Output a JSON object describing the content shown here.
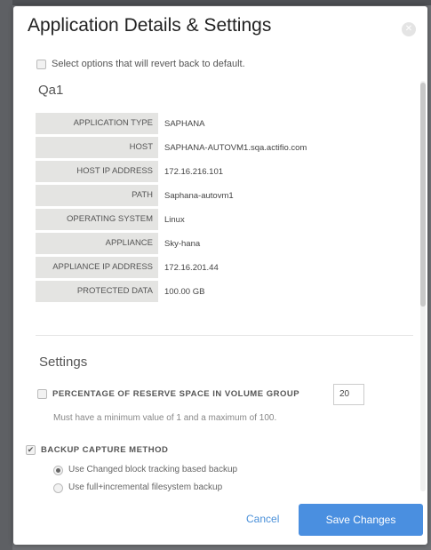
{
  "dialog": {
    "title": "Application Details & Settings",
    "revert_label": "Select options that will revert back to default.",
    "app_name": "Qa1"
  },
  "details": [
    {
      "label": "APPLICATION TYPE",
      "value": "SAPHANA"
    },
    {
      "label": "HOST",
      "value": "SAPHANA-AUTOVM1.sqa.actifio.com"
    },
    {
      "label": "HOST IP ADDRESS",
      "value": "172.16.216.101"
    },
    {
      "label": "PATH",
      "value": "Saphana-autovm1"
    },
    {
      "label": "OPERATING SYSTEM",
      "value": "Linux"
    },
    {
      "label": "APPLIANCE",
      "value": "Sky-hana"
    },
    {
      "label": "APPLIANCE IP ADDRESS",
      "value": "172.16.201.44"
    },
    {
      "label": "PROTECTED DATA",
      "value": "100.00 GB"
    }
  ],
  "settings": {
    "title": "Settings",
    "reserve_label": "PERCENTAGE OF RESERVE SPACE IN VOLUME GROUP",
    "reserve_value": "20",
    "reserve_hint": "Must have a minimum value of 1 and a maximum of 100.",
    "backup_label": "BACKUP CAPTURE METHOD",
    "backup_options": [
      {
        "label": "Use Changed block tracking based backup",
        "selected": true
      },
      {
        "label": "Use full+incremental filesystem backup",
        "selected": false
      }
    ]
  },
  "footer": {
    "cancel_label": "Cancel",
    "save_label": "Save Changes"
  },
  "colors": {
    "accent": "#4a8fe0",
    "link": "#4a90d9"
  }
}
